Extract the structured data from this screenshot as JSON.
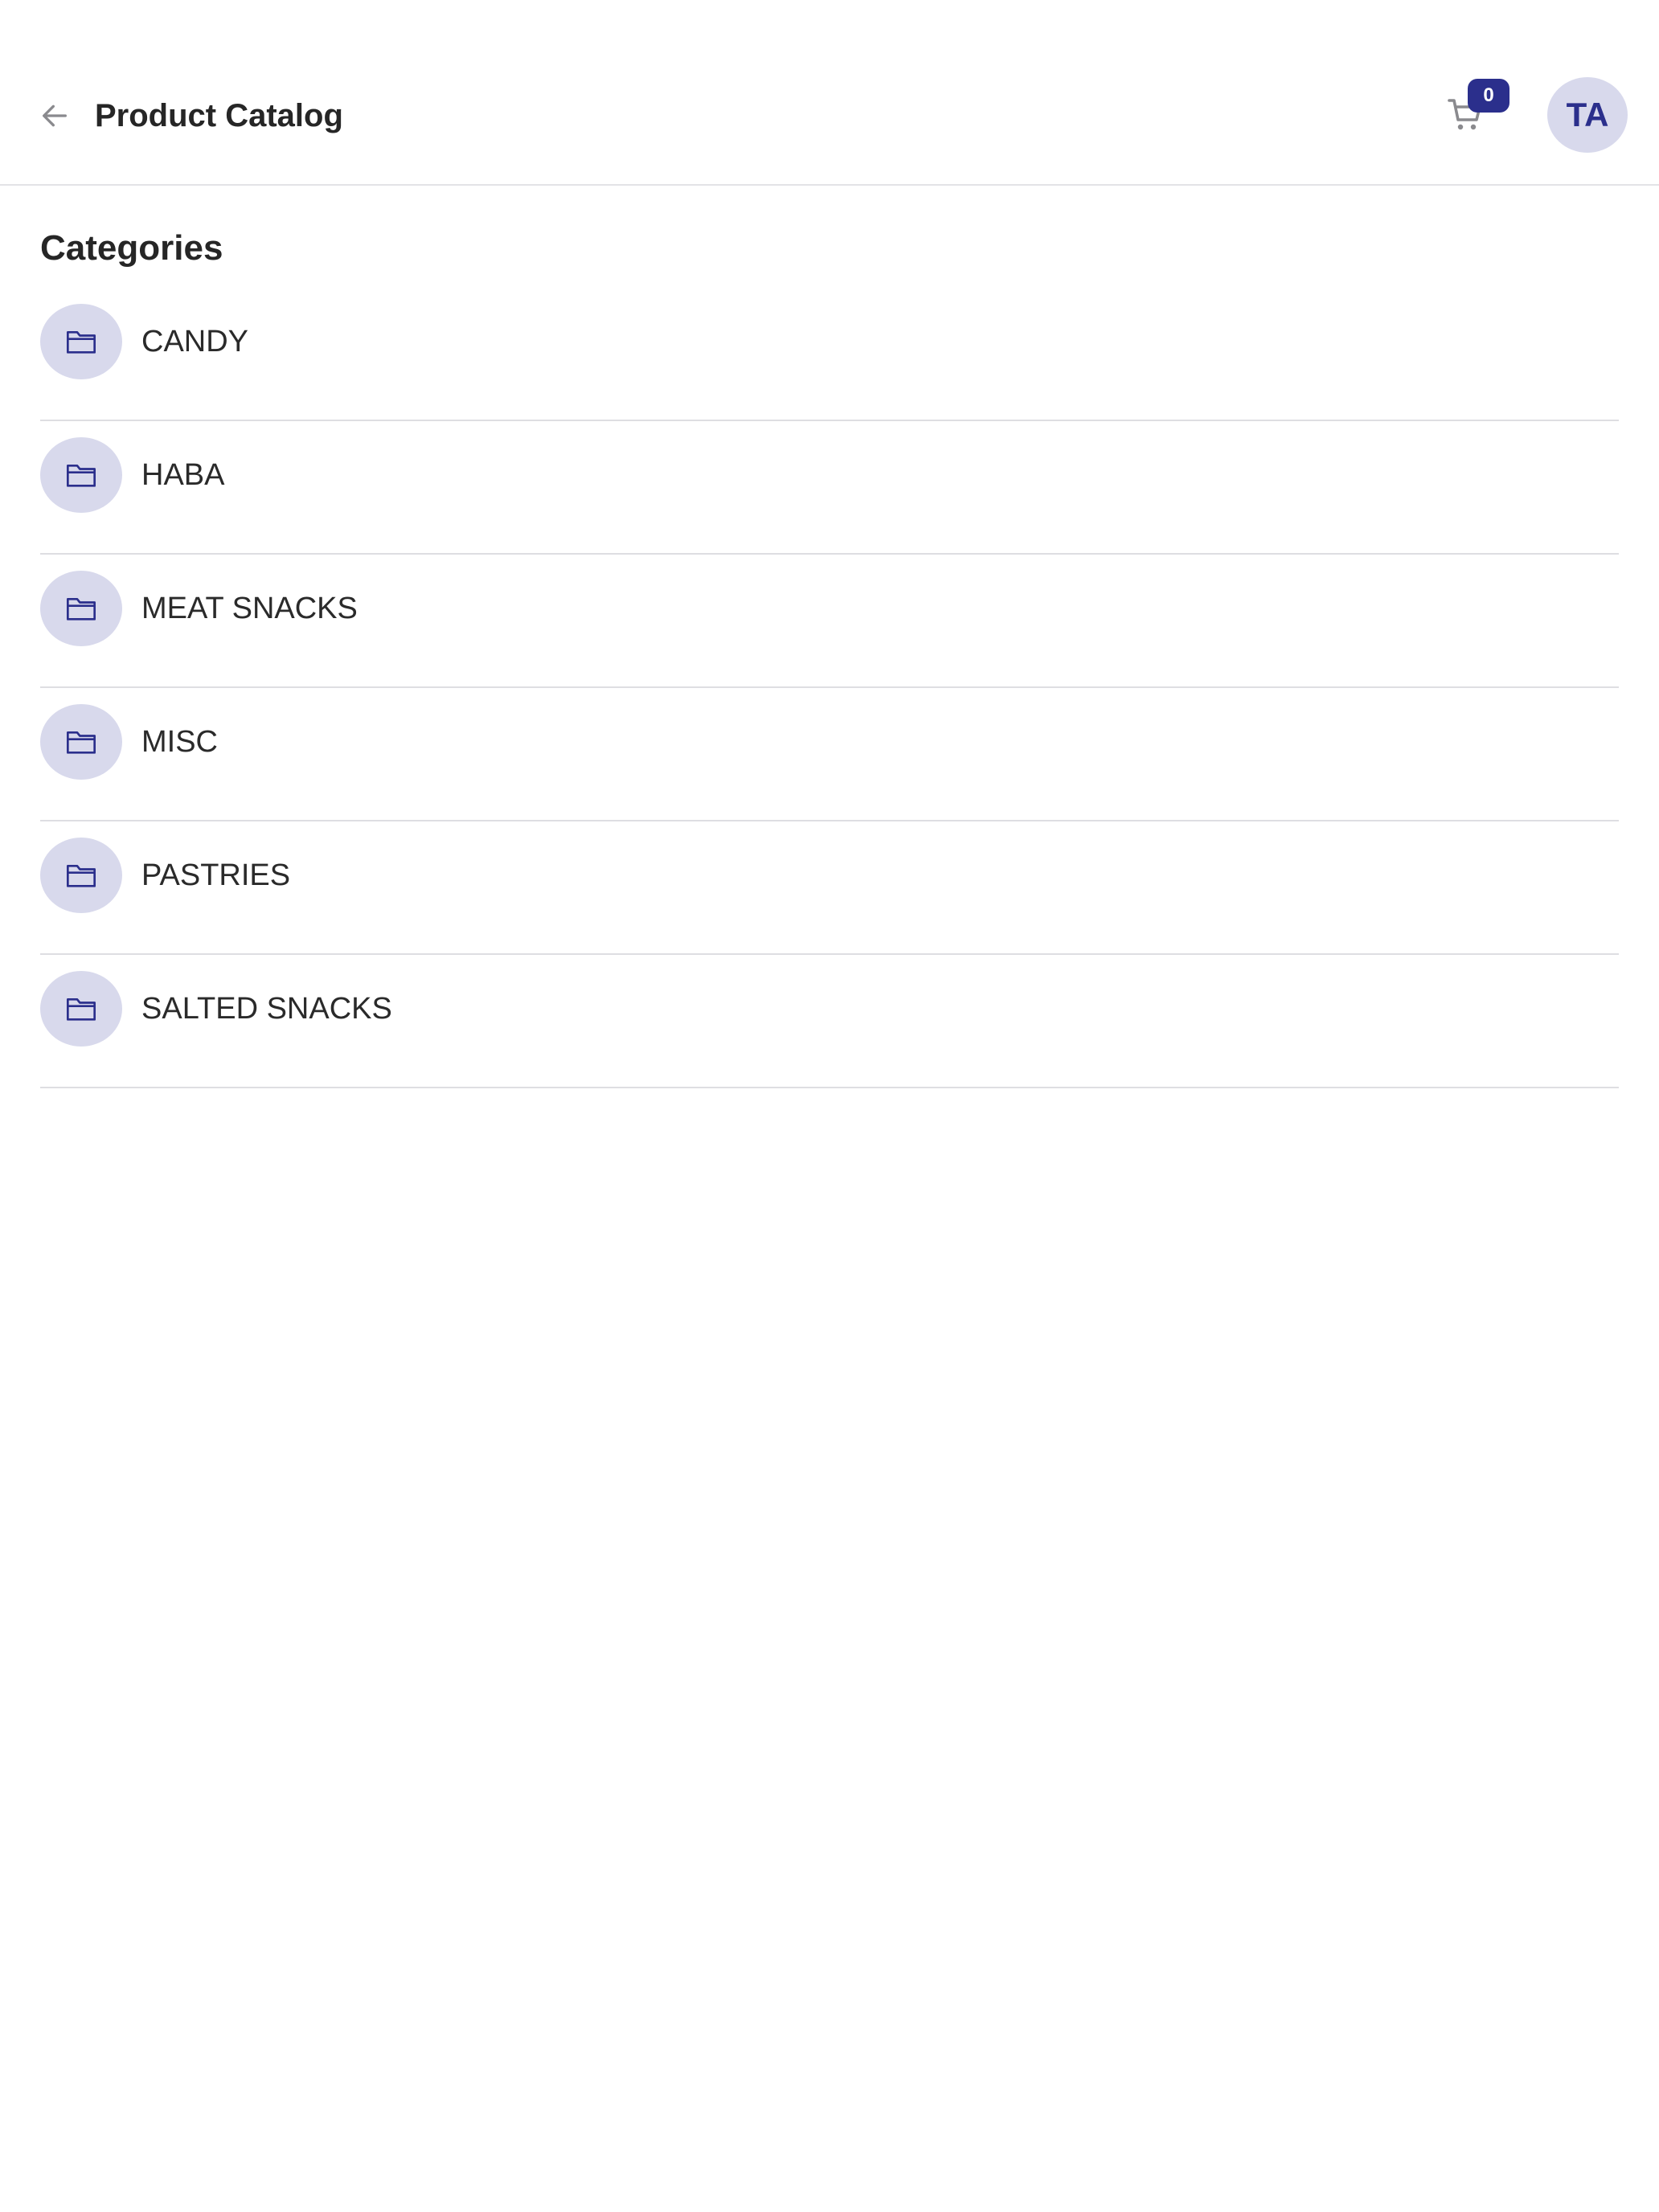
{
  "header": {
    "title": "Product Catalog",
    "back_icon": "arrow-left-icon",
    "cart_icon": "cart-icon",
    "cart_count": "0",
    "avatar_initials": "TA"
  },
  "categories": {
    "title": "Categories",
    "item_icon": "folder-icon",
    "items": [
      {
        "label": "CANDY"
      },
      {
        "label": "HABA"
      },
      {
        "label": "MEAT SNACKS"
      },
      {
        "label": "MISC"
      },
      {
        "label": "PASTRIES"
      },
      {
        "label": "SALTED SNACKS"
      }
    ]
  },
  "colors": {
    "accent": "#2b2f8c",
    "accent_light": "#d8d9ec",
    "divider": "#dedee2",
    "text": "#262626",
    "icon_gray": "#8a8a8e"
  }
}
